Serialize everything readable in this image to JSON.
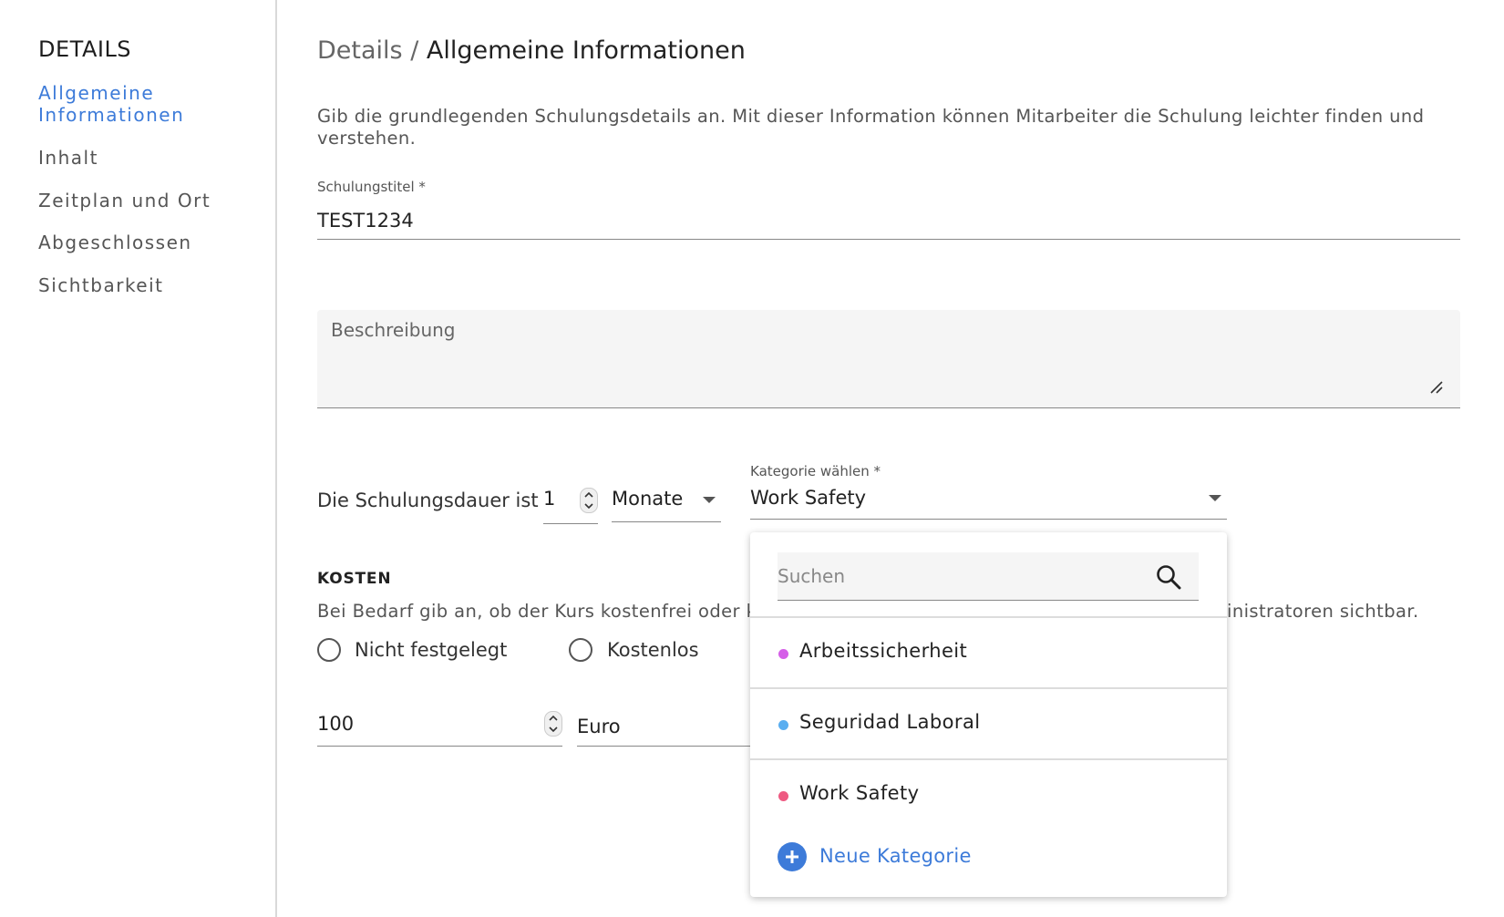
{
  "sidebar": {
    "title": "DETAILS",
    "items": [
      {
        "label_line1": "Allgemeine",
        "label_line2": "Informationen"
      },
      {
        "label": "Inhalt"
      },
      {
        "label": "Zeitplan und Ort"
      },
      {
        "label": "Abgeschlossen"
      },
      {
        "label": "Sichtbarkeit"
      }
    ]
  },
  "breadcrumb": {
    "parent": "Details",
    "separator": " / ",
    "current": "Allgemeine Informationen"
  },
  "intro": "Gib die grundlegenden Schulungsdetails an. Mit dieser Information können Mitarbeiter die Schulung leichter finden und verstehen.",
  "title_field": {
    "label": "Schulungstitel *",
    "value": "TEST1234"
  },
  "description_field": {
    "placeholder": "Beschreibung"
  },
  "duration": {
    "label": "Die Schulungsdauer ist",
    "value": "1",
    "unit": "Monate"
  },
  "category": {
    "label": "Kategorie wählen *",
    "value": "Work Safety"
  },
  "costs": {
    "title": "KOSTEN",
    "text_left": "Bei Bedarf gib an, ob der Kurs kostenfrei oder k",
    "text_right": "inistratoren sichtbar.",
    "options": [
      "Nicht festgelegt",
      "Kostenlos"
    ],
    "amount": "100",
    "currency": "Euro"
  },
  "dropdown": {
    "search_placeholder": "Suchen",
    "options": [
      {
        "label": "Arbeitssicherheit",
        "color": "#d55ee8"
      },
      {
        "label": "Seguridad Laboral",
        "color": "#5aaef0"
      },
      {
        "label": "Work Safety",
        "color": "#ee5a82"
      }
    ],
    "new_label": "Neue Kategorie"
  },
  "colors": {
    "accent": "#3d7bd9"
  }
}
